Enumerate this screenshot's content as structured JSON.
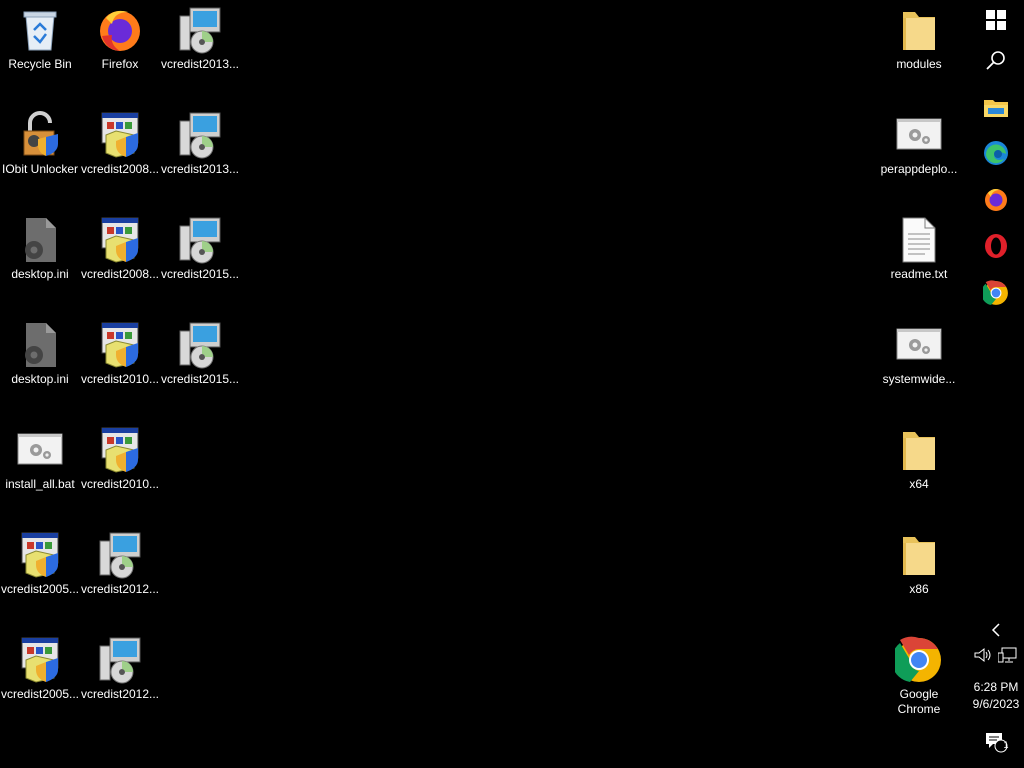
{
  "desktop": {
    "left_icons": [
      {
        "label": "Recycle Bin",
        "icon": "recycle-bin-icon"
      },
      {
        "label": "Firefox",
        "icon": "firefox-icon"
      },
      {
        "label": "vcredist2013...",
        "icon": "installer-cd-icon"
      },
      {
        "label": "IObit Unlocker",
        "icon": "iobit-unlocker-icon"
      },
      {
        "label": "vcredist2008...",
        "icon": "installer-window-icon"
      },
      {
        "label": "vcredist2013...",
        "icon": "installer-cd-icon"
      },
      {
        "label": "desktop.ini",
        "icon": "settings-file-icon"
      },
      {
        "label": "vcredist2008...",
        "icon": "installer-window-icon"
      },
      {
        "label": "vcredist2015...",
        "icon": "installer-cd-icon"
      },
      {
        "label": "desktop.ini",
        "icon": "settings-file-icon"
      },
      {
        "label": "vcredist2010...",
        "icon": "installer-window-icon"
      },
      {
        "label": "vcredist2015...",
        "icon": "installer-cd-icon"
      },
      {
        "label": "install_all.bat",
        "icon": "batch-file-icon"
      },
      {
        "label": "vcredist2010...",
        "icon": "installer-window-icon"
      },
      {
        "label": "vcredist2005...",
        "icon": "installer-window-icon"
      },
      {
        "label": "vcredist2012...",
        "icon": "installer-cd-icon"
      },
      {
        "label": "vcredist2005...",
        "icon": "installer-window-icon"
      },
      {
        "label": "vcredist2012...",
        "icon": "installer-cd-icon"
      }
    ],
    "right_icons": [
      {
        "label": "modules",
        "icon": "folder-icon"
      },
      {
        "label": "perappdeplo...",
        "icon": "batch-file-icon"
      },
      {
        "label": "readme.txt",
        "icon": "text-file-icon"
      },
      {
        "label": "systemwide...",
        "icon": "batch-file-icon"
      },
      {
        "label": "x64",
        "icon": "folder-icon"
      },
      {
        "label": "x86",
        "icon": "folder-icon"
      },
      {
        "label": "Google Chrome",
        "icon": "chrome-icon"
      }
    ]
  },
  "taskbar": {
    "items": [
      "start-windows-icon",
      "search-icon",
      "file-explorer-icon",
      "edge-icon",
      "firefox-icon",
      "opera-icon",
      "chrome-icon"
    ],
    "tray": {
      "time": "6:28 PM",
      "date": "9/6/2023",
      "notification_count": "1"
    }
  },
  "colors": {
    "background": "#000000",
    "folder": "#f3d37a",
    "chrome_red": "#db4437",
    "chrome_green": "#0f9d58",
    "chrome_yellow": "#f4b400",
    "chrome_blue": "#4285f4"
  }
}
